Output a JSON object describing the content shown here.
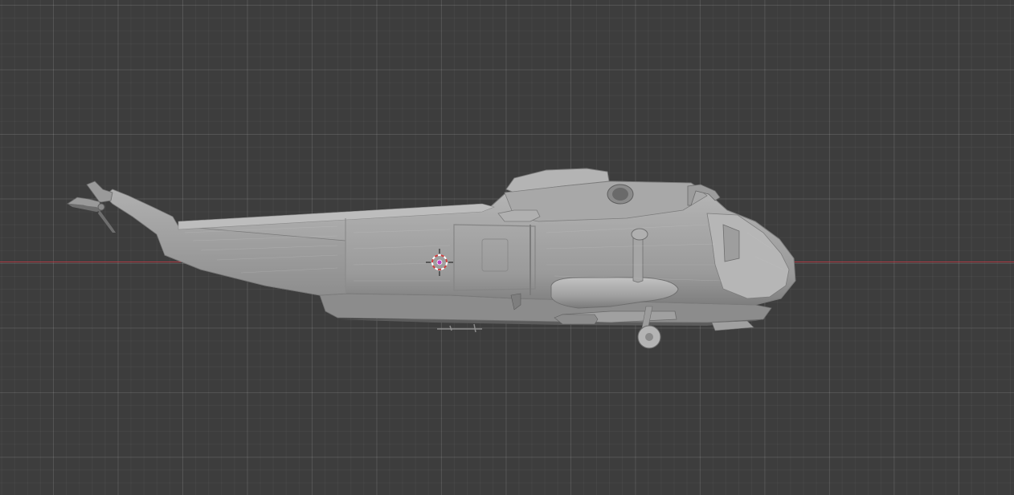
{
  "viewport": {
    "background_color": "#3d3d3d",
    "grid_color": "#4a4a4a",
    "x_axis_color": "#c23c46"
  },
  "scene": {
    "object": "helicopter-mesh",
    "shading": "solid",
    "view": "side-orthographic"
  },
  "cursor_3d": {
    "icon": "3d-cursor-icon",
    "ring_colors": [
      "#d04040",
      "#ffffff"
    ]
  },
  "origin_point": {
    "icon": "object-origin-icon",
    "color": "#c040c0"
  }
}
